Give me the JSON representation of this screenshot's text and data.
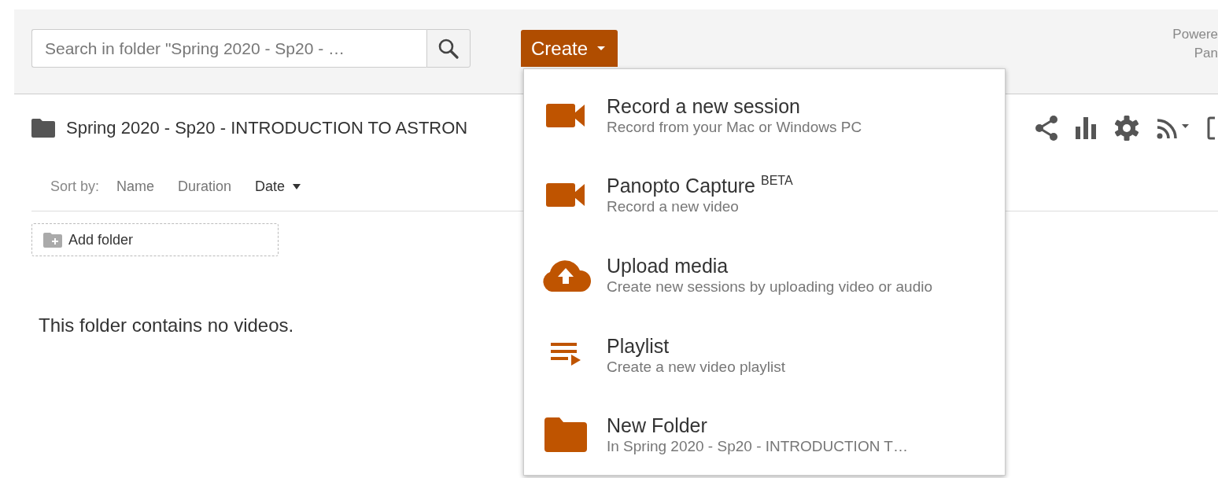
{
  "header": {
    "search": {
      "placeholder": "Search in folder \"Spring 2020 - Sp20 - …"
    },
    "create_button": {
      "label": "Create",
      "expanded": true
    },
    "powered_by": [
      "Powere",
      "Pan"
    ]
  },
  "folder": {
    "title": "Spring 2020 - Sp20 - INTRODUCTION TO ASTRON"
  },
  "sort": {
    "label": "Sort by:",
    "options": [
      {
        "label": "Name",
        "selected": false
      },
      {
        "label": "Duration",
        "selected": false
      },
      {
        "label": "Date",
        "selected": true
      }
    ]
  },
  "add_folder": {
    "label": "Add folder"
  },
  "empty_message": "This folder contains no videos.",
  "create_menu": [
    {
      "kind": "camera",
      "title": "Record a new session",
      "subtitle": "Record from your Mac or Windows PC"
    },
    {
      "kind": "camera",
      "title": "Panopto Capture $^{BETA}$",
      "subtitle": "Record a new video"
    },
    {
      "kind": "upload",
      "title": "Upload media",
      "subtitle": "Create new sessions by uploading video or audio"
    },
    {
      "kind": "playlist",
      "title": "Playlist",
      "subtitle": "Create a new video playlist"
    },
    {
      "kind": "folder",
      "title": "New Folder",
      "subtitle": "In Spring 2020 - Sp20 - INTRODUCTION T…"
    }
  ]
}
